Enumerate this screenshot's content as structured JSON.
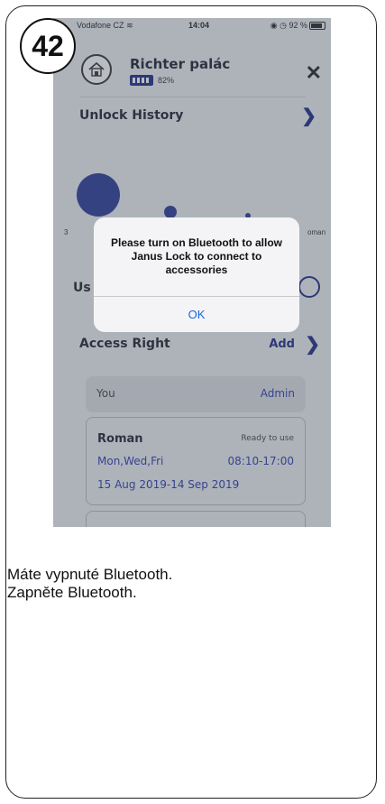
{
  "step": {
    "number": "42"
  },
  "statusbar": {
    "carrier": "Vodafone CZ",
    "time": "14:04",
    "battery_text": "92 %"
  },
  "header": {
    "lock_name": "Richter palác",
    "battery_percent": "82%",
    "battery_level": 0.82
  },
  "unlock_history": {
    "title": "Unlock History",
    "labels": [
      "3",
      "oman"
    ]
  },
  "users": {
    "label": "Us"
  },
  "access": {
    "title": "Access Right",
    "add_label": "Add",
    "entries": [
      {
        "name": "You",
        "role": "Admin"
      },
      {
        "name": "Roman",
        "status": "Ready to use",
        "days": "Mon,Wed,Fri",
        "hours": "08:10-17:00",
        "dates": "15 Aug 2019-14 Sep 2019"
      }
    ]
  },
  "alert": {
    "message": "Please turn on Bluetooth to allow Janus Lock to connect to accessories",
    "ok_label": "OK"
  },
  "caption": {
    "line1": "Máte vypnuté Bluetooth.",
    "line2": "Zapněte Bluetooth."
  },
  "colors": {
    "accent": "#1e2a88",
    "link": "#2c3bb0",
    "alert_button": "#1a64d8"
  }
}
